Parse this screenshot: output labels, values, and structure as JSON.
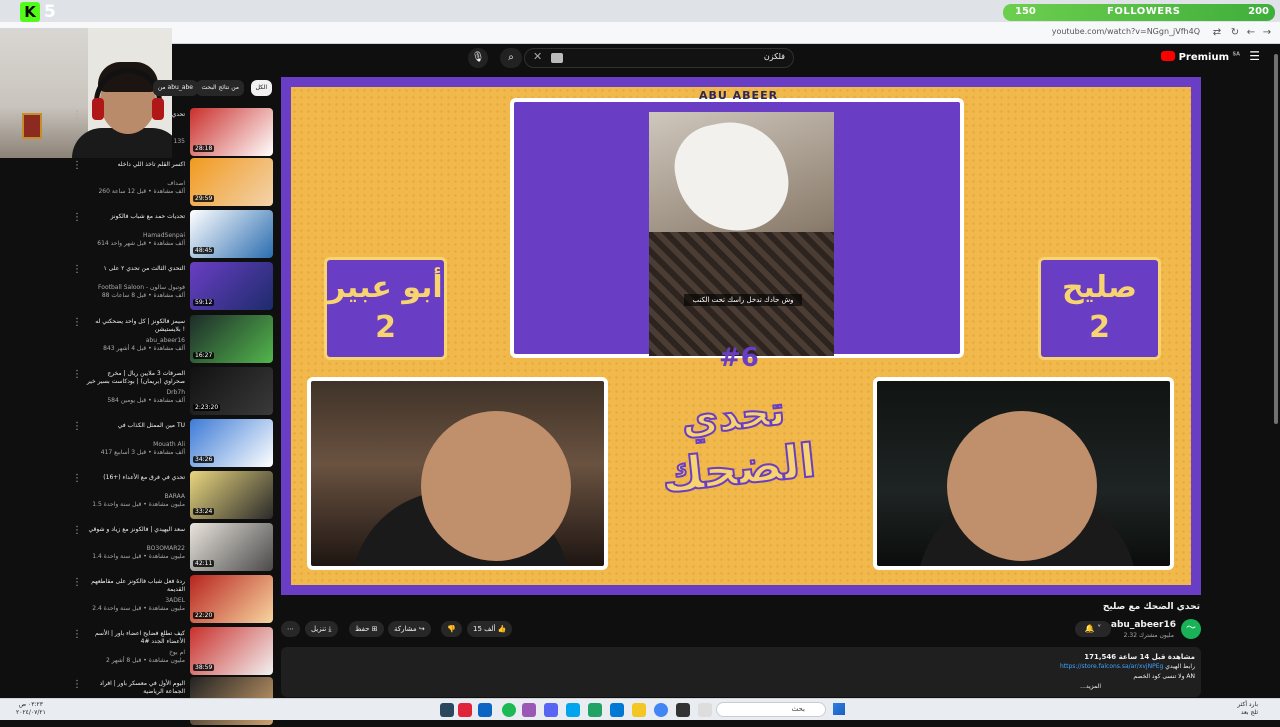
{
  "browser": {
    "url": "youtube.com/watch?v=NGgn_jVfh4Q"
  },
  "overlay": {
    "kick_logo": "K",
    "kick_count": "5",
    "followers_current": "150",
    "followers_label": "FOLLOWERS",
    "followers_goal": "200"
  },
  "header": {
    "search_value": "فلكزن",
    "premium_label": "Premium",
    "premium_region": "SA"
  },
  "filters": {
    "chips": [
      "الكل",
      "من نتائج البحث",
      "من ‎abu_abe"
    ]
  },
  "sidebar": {
    "items": [
      {
        "title": "تحدي",
        "channel": "",
        "meta": "135",
        "duration": "28:18",
        "thumb": [
          "#c9302c",
          "#ffffff"
        ]
      },
      {
        "title": "اكسر القلم تاخذ اللي داخله",
        "channel": "اصداف",
        "meta": "260 ألف مشاهدة • قبل 12 ساعة",
        "duration": "29:59",
        "thumb": [
          "#f19a1e",
          "#f3d3ad"
        ]
      },
      {
        "title": "تحديات حمد مع شباب فالكونز",
        "channel": "HamadSenpai",
        "meta": "614 ألف مشاهدة • قبل شهر واحد",
        "duration": "48:45",
        "thumb": [
          "#ffffff",
          "#2b6db0"
        ]
      },
      {
        "title": "التحدي الثالث من تحدي ٢ على ١",
        "channel": "Football Saloon - فوتبول سالون",
        "meta": "88 ألف مشاهدة • قبل 8 ساعات",
        "duration": "59:12",
        "thumb": [
          "#6a3ec4",
          "#1d2c6b"
        ]
      },
      {
        "title": "سيمز فالكونز | كل واحد يضحكني له بلايستيشن !",
        "channel": "abu_abeer16",
        "meta": "843 ألف مشاهدة • قبل 4 أشهر",
        "duration": "16:27",
        "thumb": [
          "#1d2b2a",
          "#53b64c"
        ]
      },
      {
        "title": "الصرفات 3 ملايين ريال | مخرج صحراوي (بريمان) | بودكاست بسير خير",
        "channel": "Drb7h",
        "meta": "584 ألف مشاهدة • قبل يومين",
        "duration": "2:23:20",
        "thumb": [
          "#111111",
          "#3a3a3a"
        ]
      },
      {
        "title": "مين الممثل الكذاب في TU",
        "channel": "Mouath Ali",
        "meta": "417 ألف مشاهدة • قبل 3 أسابيع",
        "duration": "34:26",
        "thumb": [
          "#3d7bd6",
          "#ffffff"
        ]
      },
      {
        "title": "تحدي في فرق مع الأعداء (+16)",
        "channel": "BARAA",
        "meta": "1.5 مليون مشاهدة • قبل سنة واحدة",
        "duration": "33:24",
        "thumb": [
          "#e9d67f",
          "#2a2a2a"
        ]
      },
      {
        "title": "سعد اليهيدي | فالكونز مع زياد و شوقي",
        "channel": "BO3OMAR22",
        "meta": "1.4 مليون مشاهدة • قبل سنة واحدة",
        "duration": "42:11",
        "thumb": [
          "#e9e4dd",
          "#4a4a4a"
        ]
      },
      {
        "title": "ردة فعل شباب فالكونز على مقاطعهم القديمة",
        "channel": "3ADEL",
        "meta": "2.4 مليون مشاهدة • قبل سنة واحدة",
        "duration": "22:20",
        "thumb": [
          "#b8241f",
          "#f7d6a1"
        ]
      },
      {
        "title": "كيف تطلع فضايح اعضاء باور | الأسم الأعضاء الجدد #4",
        "channel": "ام بوخ",
        "meta": "2 مليون مشاهدة • قبل 8 أشهر",
        "duration": "38:59",
        "thumb": [
          "#c9302c",
          "#f2f2f2"
        ]
      },
      {
        "title": "اليوم الأول في معسكر باور | افراد الجماعة الرياضية",
        "channel": "",
        "meta": "",
        "duration": "",
        "thumb": [
          "#222222",
          "#d0a36e"
        ]
      }
    ]
  },
  "video": {
    "brand": "ABU ABEER",
    "clip_caption": "وش حادك تدخل راسك تحت الكنب",
    "round": "#6",
    "art_line1": "تحدي",
    "art_line2": "الضحك",
    "player_left_name": "أبو عبير",
    "player_left_score": "2",
    "player_right_name": "صليح",
    "player_right_score": "2",
    "title": "تحدي الضحك مع صليح",
    "channel_name": "abu_abeer16",
    "subscribers": "2.32 مليون مشترك",
    "likes": "15 ألف",
    "share_label": "مشاركة",
    "save_label": "حفظ",
    "download_label": "تنزيل",
    "views_line": "171,546 مشاهدة قبل 14 ساعة",
    "desc_line2_text": "رابط الهيدي",
    "desc_link": "https://store.falcons.sa/ar/xvjNPEg",
    "desc_line3": "ولا تنسى كود الخصم AN",
    "more_label": "...المزيد"
  },
  "taskbar": {
    "clock_time": "٠٣:٢٣ ص",
    "clock_date": "٢٠٢٤/٠٧/٢١",
    "search_placeholder": "بحث",
    "weather_temp": "بارد أكثر",
    "weather_label": "ثلج بعد"
  },
  "icons": {
    "mic": "mic-icon",
    "search": "search-icon",
    "clear": "close-icon",
    "menu": "hamburger-menu-icon"
  }
}
